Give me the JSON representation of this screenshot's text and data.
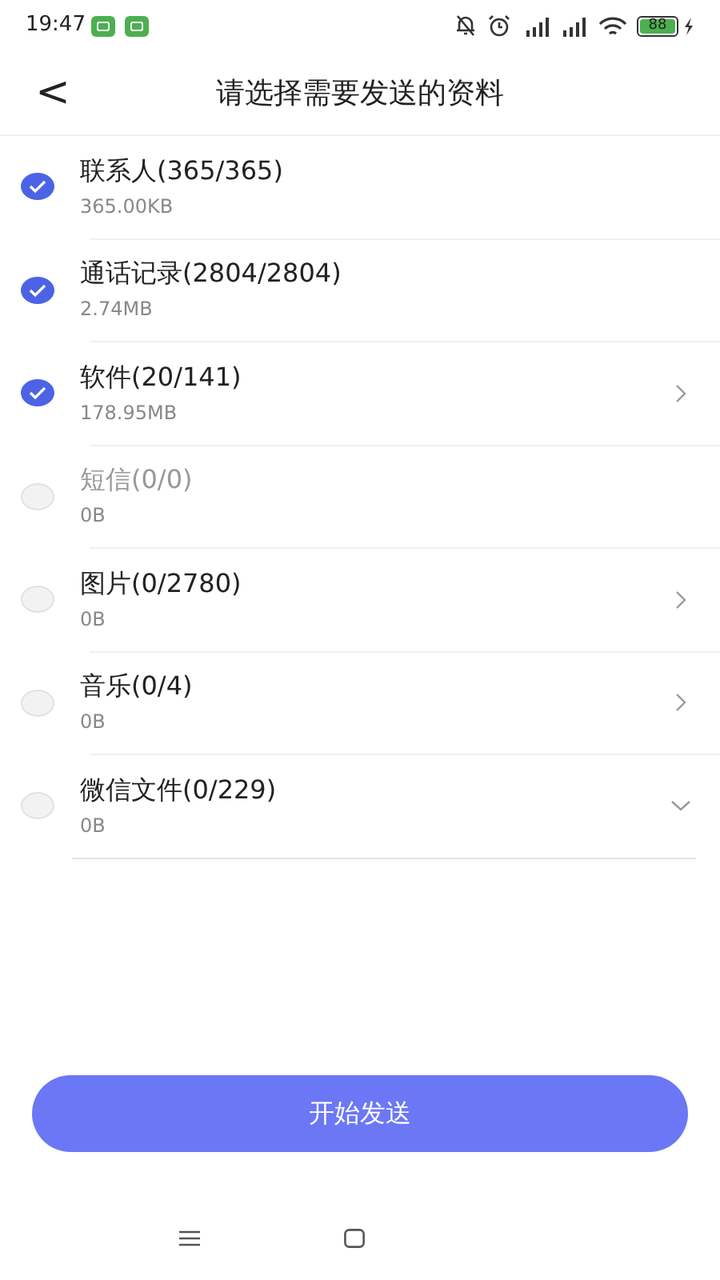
{
  "status_bar": {
    "time": "19:47",
    "battery": "88"
  },
  "header": {
    "back": "<",
    "title": "请选择需要发送的资料"
  },
  "items": [
    {
      "title": "联系人(365/365)",
      "size": "365.00KB",
      "checked": true,
      "disabled": false,
      "kind": "plain"
    },
    {
      "title": "通话记录(2804/2804)",
      "size": "2.74MB",
      "checked": true,
      "disabled": false,
      "kind": "plain"
    },
    {
      "title": "软件(20/141)",
      "size": "178.95MB",
      "checked": true,
      "disabled": false,
      "kind": "arrow"
    },
    {
      "title": "短信(0/0)",
      "size": "0B",
      "checked": false,
      "disabled": true,
      "kind": "plain"
    },
    {
      "title": "图片(0/2780)",
      "size": "0B",
      "checked": false,
      "disabled": false,
      "kind": "arrow"
    },
    {
      "title": "音乐(0/4)",
      "size": "0B",
      "checked": false,
      "disabled": false,
      "kind": "arrow"
    },
    {
      "title": "微信文件(0/229)",
      "size": "0B",
      "checked": false,
      "disabled": false,
      "kind": "expand"
    }
  ],
  "send_button": "开始发送"
}
